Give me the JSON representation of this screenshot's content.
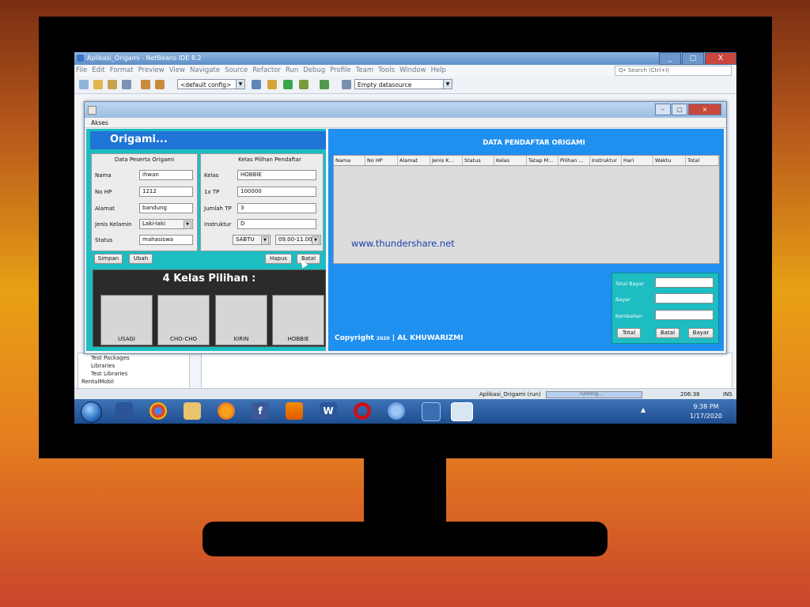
{
  "ide": {
    "window_title": "Aplikasi_Origami - NetBeans IDE 8.2",
    "window_controls": [
      "_",
      "▢",
      "X"
    ],
    "menu": [
      "File",
      "Edit",
      "Format",
      "Preview",
      "View",
      "Navigate",
      "Source",
      "Refactor",
      "Run",
      "Debug",
      "Profile",
      "Team",
      "Tools",
      "Window",
      "Help"
    ],
    "search_placeholder": "Q• Search (Ctrl+I)",
    "config_select": "<default config>",
    "datasource_select": "Empty datasource",
    "project_tree": [
      "Test Packages",
      "Libraries",
      "Test Libraries",
      "RentalMobil"
    ],
    "status": {
      "app": "Aplikasi_Origami (run)",
      "progress_text": "running...",
      "position": "206:38",
      "mode": "INS"
    }
  },
  "app": {
    "menu": "Akses",
    "header": "Origami...",
    "peserta": {
      "title": "Data Peserta Origami",
      "nama_label": "Nama",
      "nama_value": "ihwan",
      "nohp_label": "No HP",
      "nohp_value": "1212",
      "alamat_label": "Alamat",
      "alamat_value": "bandung",
      "jk_label": "Jenis Kelamin",
      "jk_value": "Laki-laki",
      "status_label": "Status",
      "status_value": "mahasiswa"
    },
    "kelas_pilihan": {
      "title": "Kelas Pilihan Pendaftar",
      "kelas_label": "Kelas",
      "kelas_value": "HOBBIE",
      "tp_label": "1x TP",
      "tp_value": "100000",
      "jumlah_label": "Jumlah TP",
      "jumlah_value": "3",
      "instruktur_label": "Instruktur",
      "instruktur_value": "D",
      "hari_value": "SABTU",
      "waktu_value": "09.00-11.00"
    },
    "buttons": {
      "simpan": "Simpan",
      "ubah": "Ubah",
      "hapus": "Hapus",
      "batal": "Batal"
    },
    "kelas_panel": {
      "title": "4 Kelas Pilihan :",
      "cards": [
        "USAGI",
        "CHO-CHO",
        "KIRIN",
        "HOBBIE"
      ]
    },
    "table": {
      "title": "DATA PENDAFTAR ORIGAMI",
      "columns": [
        "Nama",
        "No HP",
        "Alamat",
        "Jenis K...",
        "Status",
        "Kelas",
        "Tatap M...",
        "Pilihan ...",
        "Instruktur",
        "Hari",
        "Waktu",
        "Total"
      ]
    },
    "watermark": "www.thundershare.net",
    "copyright_prefix": "Copyright",
    "copyright_year": "2020",
    "copyright_sep": "|",
    "copyright_name": "AL KHUWARIZMI",
    "payment": {
      "total_bayar_label": "Total Bayar",
      "bayar_label": "Bayar",
      "kembalian_label": "Kembalian",
      "total_btn": "Total",
      "batal_btn": "Batal",
      "bayar_btn": "Bayar"
    }
  },
  "taskbar": {
    "time": "9:38 PM",
    "date": "1/17/2020",
    "tray_arrow": "▲"
  },
  "colors": {
    "app_left_panel": "#1dbdc2",
    "app_right_panel": "#1f8ff0",
    "header_bar": "#1f75d6",
    "taskbar": "#1e4d8f"
  },
  "icons": [
    "windows-start-icon",
    "explorer-icon",
    "chrome-icon",
    "folder-icon",
    "firefox-icon",
    "facebook-icon",
    "vlc-icon",
    "word-icon",
    "opera-icon",
    "virtualbox-icon",
    "netbeans-icon",
    "java-icon"
  ]
}
